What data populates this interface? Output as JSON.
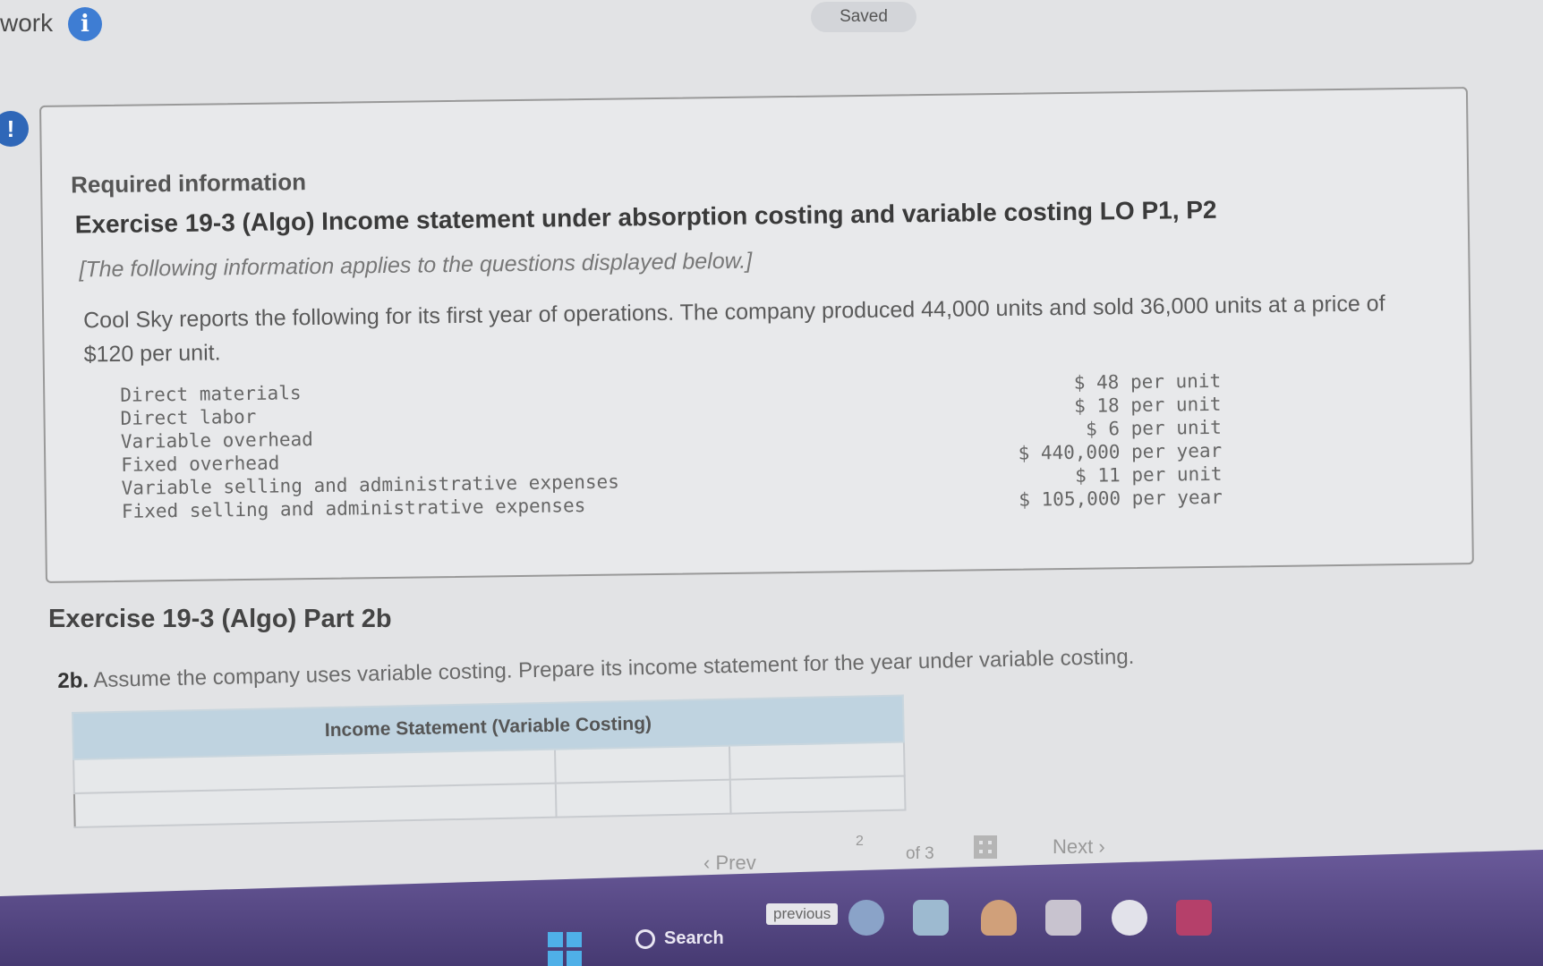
{
  "header": {
    "app_title": "work",
    "info_icon": "i",
    "status": "Saved"
  },
  "alert_icon": "!",
  "info_box": {
    "heading": "Required information",
    "exercise_title": "Exercise 19-3 (Algo) Income statement under absorption costing and variable costing LO P1, P2",
    "note": "[The following information applies to the questions displayed below.]",
    "description": "Cool Sky reports the following for its first year of operations. The company produced 44,000 units and sold 36,000 units at a price of $120 per unit.",
    "costs": [
      {
        "label": "Direct materials",
        "amount": "$ 48 per unit"
      },
      {
        "label": "Direct labor",
        "amount": "$ 18 per unit"
      },
      {
        "label": "Variable overhead",
        "amount": "$ 6 per unit"
      },
      {
        "label": "Fixed overhead",
        "amount": "$ 440,000 per year"
      },
      {
        "label": "Variable selling and administrative expenses",
        "amount": "$ 11 per unit"
      },
      {
        "label": "Fixed selling and administrative expenses",
        "amount": "$ 105,000 per year"
      }
    ]
  },
  "part": {
    "title": "Exercise 19-3 (Algo) Part 2b",
    "question_number": "2b.",
    "question_text": "Assume the company uses variable costing. Prepare its income statement for the year under variable costing."
  },
  "income_statement": {
    "header": "Income Statement (Variable Costing)"
  },
  "pager": {
    "prev_label": "Prev",
    "current_page": "2",
    "of_label": "of 3",
    "next_label": "Next"
  },
  "taskbar": {
    "search_label": "Search",
    "tooltip": "previous"
  }
}
